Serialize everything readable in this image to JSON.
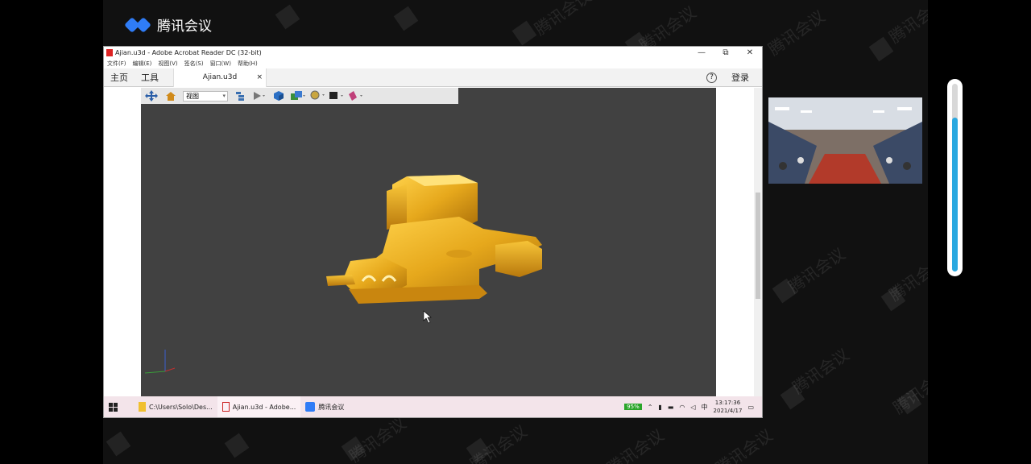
{
  "app": {
    "name": "腾讯会议"
  },
  "watermark": "腾讯会议",
  "acrobat": {
    "window_title": "Ajian.u3d - Adobe Acrobat Reader DC (32-bit)",
    "controls": [
      "—",
      "⧉",
      "✕"
    ],
    "menu": [
      "文件(F)",
      "编辑(E)",
      "视图(V)",
      "签名(S)",
      "窗口(W)",
      "帮助(H)"
    ],
    "tabs": {
      "home": "主页",
      "tools": "工具",
      "document": "Ajian.u3d",
      "close": "×"
    },
    "help": "?",
    "login": "登录",
    "toolbar": {
      "view_value": "视图"
    }
  },
  "taskbar": {
    "explorer": "C:\\Users\\Solo\\Des...",
    "acrobat": "Ajian.u3d - Adobe...",
    "meeting": "腾讯会议",
    "battery": "95%",
    "ime": "中",
    "time": "13:17:36",
    "date": "2021/4/17"
  },
  "volume_level": 0.82,
  "colors": {
    "brand": "#2f7cf6",
    "viewport": "#414141",
    "model": "#e0a820",
    "slider": "#29a8e0"
  }
}
